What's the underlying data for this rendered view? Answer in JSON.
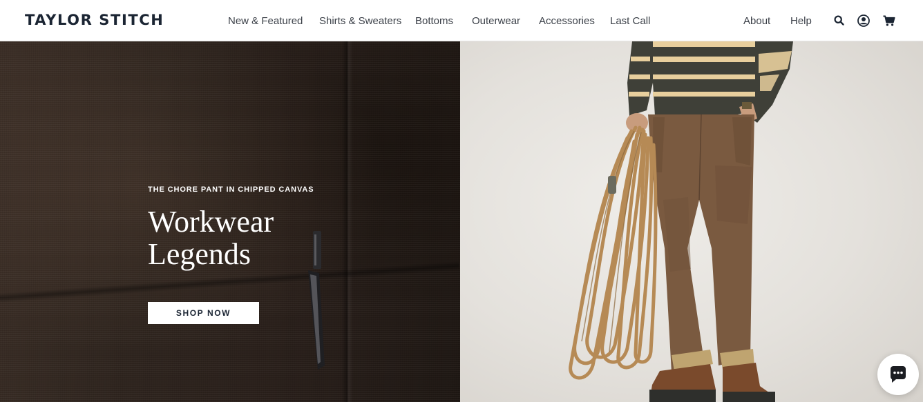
{
  "header": {
    "logo": "TAYLOR STITCH",
    "nav": [
      {
        "label": "New & Featured"
      },
      {
        "label": "Shirts & Sweaters"
      },
      {
        "label": "Bottoms"
      },
      {
        "label": "Outerwear"
      },
      {
        "label": "Accessories"
      },
      {
        "label": "Last Call"
      }
    ],
    "secondary_nav": [
      {
        "label": "About"
      },
      {
        "label": "Help"
      }
    ],
    "icons": [
      "search-icon",
      "account-icon",
      "cart-icon"
    ]
  },
  "hero": {
    "eyebrow": "THE CHORE PANT IN CHIPPED CANVAS",
    "headline_line1": "Workwear",
    "headline_line2": "Legends",
    "cta_label": "SHOP NOW"
  },
  "chat": {
    "icon": "chat-icon"
  },
  "colors": {
    "brand_navy": "#1b2533",
    "canvas_brown": "#2e241e",
    "backdrop": "#e7e4df"
  }
}
